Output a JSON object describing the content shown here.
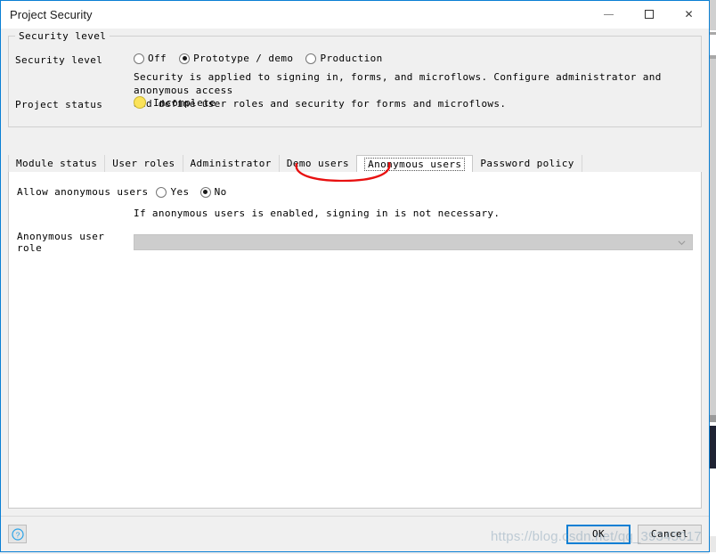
{
  "window": {
    "title": "Project Security",
    "controls": {
      "minimize": "minimize-icon",
      "maximize": "maximize-icon",
      "close": "✕"
    }
  },
  "security_group": {
    "legend": "Security level",
    "level_label": "Security level",
    "level_options": [
      {
        "label": "Off",
        "checked": false
      },
      {
        "label": "Prototype / demo",
        "checked": true
      },
      {
        "label": "Production",
        "checked": false
      }
    ],
    "description_line1": "Security is applied to signing in, forms, and microflows. Configure administrator and anonymous access",
    "description_line2": "and define user roles and security for forms and microflows.",
    "status_label": "Project status",
    "status_value": "Incomplete",
    "status_color": "#fbe35a"
  },
  "tabs": [
    {
      "label": "Module status",
      "selected": false
    },
    {
      "label": "User roles",
      "selected": false
    },
    {
      "label": "Administrator",
      "selected": false
    },
    {
      "label": "Demo users",
      "selected": false
    },
    {
      "label": "Anonymous users",
      "selected": true
    },
    {
      "label": "Password policy",
      "selected": false
    }
  ],
  "annotation": {
    "shape": "ellipse",
    "color": "#e81010",
    "target": "Anonymous users"
  },
  "anonymous_tab": {
    "allow_label": "Allow anonymous users",
    "allow_options": [
      {
        "label": "Yes",
        "checked": false
      },
      {
        "label": "No",
        "checked": true
      }
    ],
    "hint": "If anonymous users is enabled, signing in is not necessary.",
    "role_label": "Anonymous user role",
    "role_value": "",
    "role_disabled": true
  },
  "footer": {
    "help_label": "?",
    "ok_label": "OK",
    "cancel_label": "Cancel"
  },
  "watermark": {
    "text": "https://blog.csdn.net/qq_39345017"
  }
}
